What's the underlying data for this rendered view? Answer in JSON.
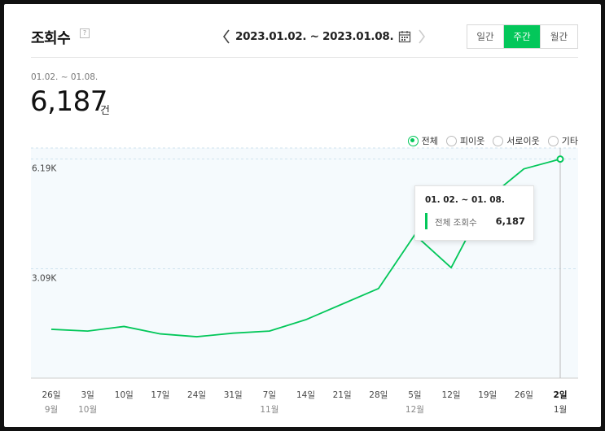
{
  "header": {
    "title": "조회수",
    "help_glyph": "?",
    "date_range": "2023.01.02. ~ 2023.01.08.",
    "period_tabs": [
      {
        "label": "일간",
        "active": false
      },
      {
        "label": "주간",
        "active": true
      },
      {
        "label": "월간",
        "active": false
      }
    ]
  },
  "summary": {
    "range": "01.02. ~ 01.08.",
    "count": "6,187",
    "unit": "건"
  },
  "filters": [
    {
      "label": "전체",
      "selected": true
    },
    {
      "label": "피이웃",
      "selected": false
    },
    {
      "label": "서로이웃",
      "selected": false
    },
    {
      "label": "기타",
      "selected": false
    }
  ],
  "tooltip": {
    "range": "01. 02. ~ 01. 08.",
    "label": "전체 조회수",
    "value": "6,187"
  },
  "colors": {
    "accent": "#03c75a",
    "plot_bg": "#f5fafd",
    "grid": "#cfe3ee"
  },
  "chart_data": {
    "type": "line",
    "y_tick_labels": [
      "6.19K",
      "3.09K"
    ],
    "y_ticks": [
      6190,
      3090
    ],
    "ylim": [
      0,
      6500
    ],
    "x": [
      {
        "day": "26일",
        "month": "9월"
      },
      {
        "day": "3일",
        "month": "10월"
      },
      {
        "day": "10일",
        "month": ""
      },
      {
        "day": "17일",
        "month": ""
      },
      {
        "day": "24일",
        "month": ""
      },
      {
        "day": "31일",
        "month": ""
      },
      {
        "day": "7일",
        "month": "11월"
      },
      {
        "day": "14일",
        "month": ""
      },
      {
        "day": "21일",
        "month": ""
      },
      {
        "day": "28일",
        "month": ""
      },
      {
        "day": "5일",
        "month": "12월"
      },
      {
        "day": "12일",
        "month": ""
      },
      {
        "day": "19일",
        "month": ""
      },
      {
        "day": "26일",
        "month": ""
      },
      {
        "day": "2일",
        "month": "1월",
        "highlight": true
      }
    ],
    "series": [
      {
        "values": [
          1380,
          1330,
          1460,
          1250,
          1170,
          1270,
          1330,
          1650,
          2090,
          2530,
          4050,
          3120,
          5070,
          5910,
          6187
        ]
      }
    ],
    "grid": true,
    "highlighted_index": 14
  }
}
